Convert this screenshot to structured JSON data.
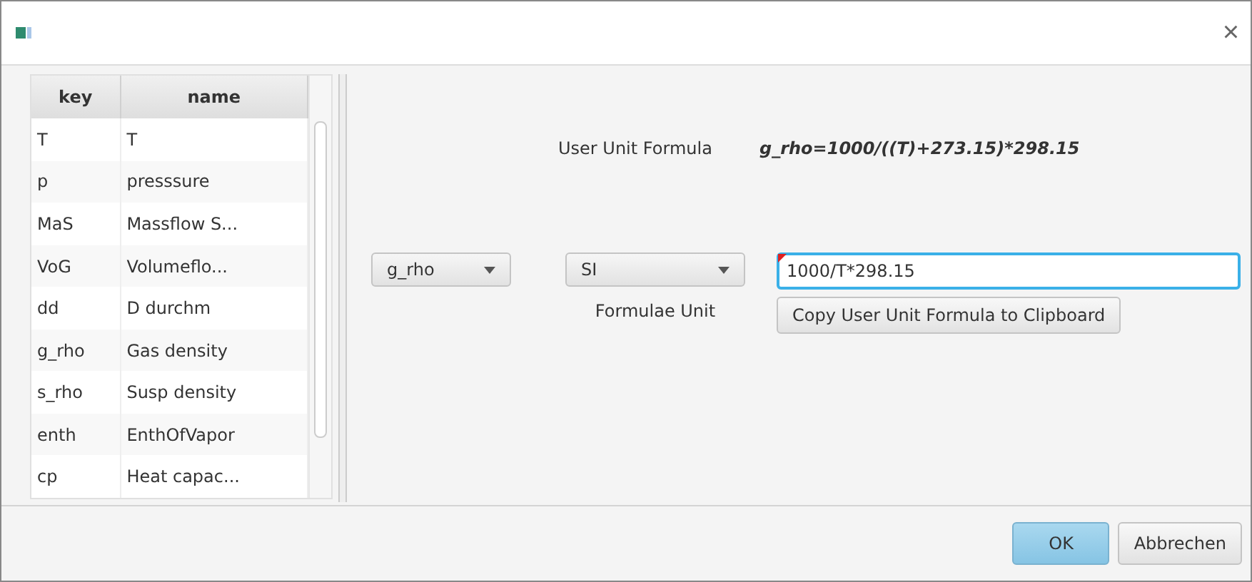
{
  "window": {
    "close_glyph": "×"
  },
  "table": {
    "columns": [
      "key",
      "name"
    ],
    "rows": [
      [
        "T",
        "T"
      ],
      [
        "p",
        "presssure"
      ],
      [
        "MaS",
        "Massflow S..."
      ],
      [
        "VoG",
        "Volumeflo..."
      ],
      [
        "dd",
        "D durchm"
      ],
      [
        "g_rho",
        "Gas density"
      ],
      [
        "s_rho",
        "Susp density"
      ],
      [
        "enth",
        "EnthOfVapor"
      ],
      [
        "cp",
        "Heat capac..."
      ]
    ]
  },
  "user_unit_formula": {
    "label": "User Unit Formula",
    "value": "g_rho=1000/((T)+273.15)*298.15"
  },
  "variable_select": {
    "value": "g_rho"
  },
  "unit_select": {
    "value": "SI",
    "label": "Formulae Unit"
  },
  "formula_field": {
    "value": "1000/T*298.15",
    "error": true
  },
  "copy_button": "Copy User Unit Formula to Clipboard",
  "buttons": [
    {
      "label": "OK",
      "default": true
    },
    {
      "label": "Abbrechen",
      "default": false
    }
  ]
}
